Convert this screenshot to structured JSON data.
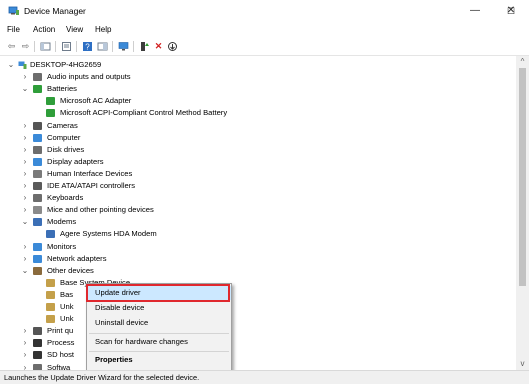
{
  "window": {
    "title": "Device Manager",
    "minimize": "—",
    "maximize": "☐",
    "close": "✕"
  },
  "menu": [
    "File",
    "Action",
    "View",
    "Help"
  ],
  "toolbar_icons": [
    "back-icon",
    "forward-icon",
    "show-hide-console-tree-icon",
    "properties-icon",
    "help-icon",
    "details-pane-icon",
    "monitor-icon",
    "update-driver-icon",
    "uninstall-icon",
    "scan-hardware-icon"
  ],
  "tree": {
    "root": "DESKTOP-4HG2659",
    "items": [
      {
        "label": "Audio inputs and outputs"
      },
      {
        "label": "Batteries"
      },
      {
        "label": "Microsoft AC Adapter"
      },
      {
        "label": "Microsoft ACPI-Compliant Control Method Battery"
      },
      {
        "label": "Cameras"
      },
      {
        "label": "Computer"
      },
      {
        "label": "Disk drives"
      },
      {
        "label": "Display adapters"
      },
      {
        "label": "Human Interface Devices"
      },
      {
        "label": "IDE ATA/ATAPI controllers"
      },
      {
        "label": "Keyboards"
      },
      {
        "label": "Mice and other pointing devices"
      },
      {
        "label": "Modems"
      },
      {
        "label": "Agere Systems HDA Modem"
      },
      {
        "label": "Monitors"
      },
      {
        "label": "Network adapters"
      },
      {
        "label": "Other devices"
      },
      {
        "label": "Base System Device"
      },
      {
        "label": "Bas"
      },
      {
        "label": "Unk"
      },
      {
        "label": "Unk"
      },
      {
        "label": "Print qu"
      },
      {
        "label": "Process"
      },
      {
        "label": "SD host"
      },
      {
        "label": "Softwa"
      }
    ]
  },
  "context_menu": {
    "items": [
      {
        "label": "Update driver",
        "highlighted": true
      },
      {
        "label": "Disable device"
      },
      {
        "label": "Uninstall device"
      },
      {
        "label": "Scan for hardware changes"
      },
      {
        "label": "Properties"
      }
    ]
  },
  "status": "Launches the Update Driver Wizard for the selected device.",
  "scrollbar": {
    "up": "^",
    "down": "v"
  },
  "colors": {
    "highlight": "#cce8ff",
    "annotation_box": "#e0282e"
  }
}
